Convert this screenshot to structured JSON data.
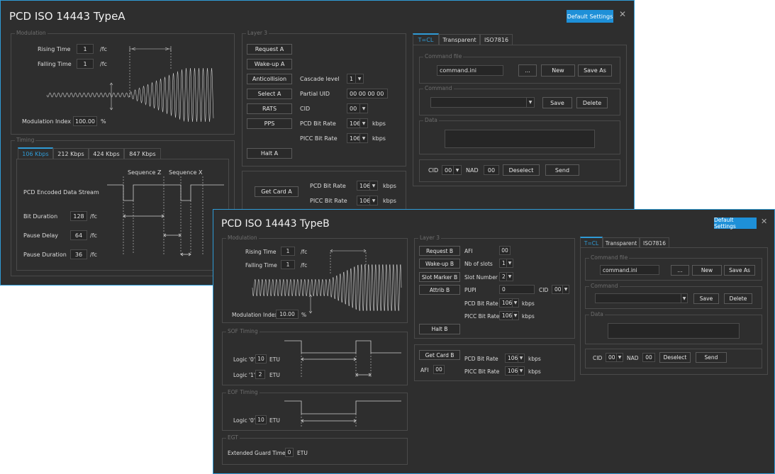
{
  "win_a": {
    "title": "PCD ISO 14443 TypeA",
    "default_settings": "Default Settings",
    "close": "✕",
    "modulation": {
      "label": "Modulation",
      "rising_time_label": "Rising Time",
      "rising_time": "1",
      "rising_unit": "/fc",
      "falling_time_label": "Falling Time",
      "falling_time": "1",
      "falling_unit": "/fc",
      "index_label": "Modulation Index",
      "index": "100.00",
      "index_unit": "%"
    },
    "timing": {
      "label": "Timing",
      "tabs": [
        "106 Kbps",
        "212 Kbps",
        "424 Kbps",
        "847 Kbps"
      ],
      "seq_z": "Sequence Z",
      "seq_x": "Sequence X",
      "stream_label": "PCD Encoded Data Stream",
      "bit_duration_label": "Bit Duration",
      "bit_duration": "128",
      "pause_delay_label": "Pause Delay",
      "pause_delay": "64",
      "pause_duration_label": "Pause Duration",
      "pause_duration": "36",
      "unit": "/fc"
    },
    "layer3": {
      "label": "Layer 3",
      "request_a": "Request A",
      "wakeup_a": "Wake-up A",
      "anticollision": "Anticollision",
      "select_a": "Select A",
      "rats": "RATS",
      "pps": "PPS",
      "halt_a": "Halt A",
      "cascade_label": "Cascade level",
      "cascade": "1",
      "partial_uid_label": "Partial UID",
      "partial_uid": "00 00 00 00",
      "cid_label": "CID",
      "cid": "00",
      "pcd_rate_label": "PCD Bit Rate",
      "pcd_rate": "106",
      "picc_rate_label": "PICC Bit Rate",
      "picc_rate": "106",
      "unit": "kbps"
    },
    "getcard": {
      "button": "Get Card A",
      "pcd_rate_label": "PCD Bit Rate",
      "pcd_rate": "106",
      "picc_rate_label": "PICC Bit Rate",
      "picc_rate": "106",
      "unit": "kbps"
    },
    "right": {
      "tabs": [
        "T=CL",
        "Transparent",
        "ISO7816"
      ],
      "command_file_label": "Command file",
      "command_file": "command.ini",
      "browse": "...",
      "new": "New",
      "save_as": "Save As",
      "command_label": "Command",
      "save": "Save",
      "delete": "Delete",
      "data_label": "Data",
      "cid_label": "CID",
      "cid": "00",
      "nad_label": "NAD",
      "nad": "00",
      "deselect": "Deselect",
      "send": "Send"
    }
  },
  "win_b": {
    "title": "PCD ISO 14443 TypeB",
    "default_settings": "Default Settings",
    "close": "✕",
    "modulation": {
      "label": "Modulation",
      "rising_time_label": "Rising Time",
      "rising_time": "1",
      "rising_unit": "/fc",
      "falling_time_label": "Falling Time",
      "falling_time": "1",
      "falling_unit": "/fc",
      "index_label": "Modulation Index",
      "index": "10.00",
      "index_unit": "%"
    },
    "sof": {
      "label": "SOF Timing",
      "logic0_label": "Logic '0'",
      "logic0": "10",
      "logic1_label": "Logic '1'",
      "logic1": "2",
      "unit": "ETU"
    },
    "eof": {
      "label": "EOF Timing",
      "logic0_label": "Logic '0'",
      "logic0": "10",
      "unit": "ETU"
    },
    "egt": {
      "label": "EGT",
      "label2": "Extended Guard Time",
      "value": "0",
      "unit": "ETU"
    },
    "layer3": {
      "label": "Layer 3",
      "request_b": "Request B",
      "wakeup_b": "Wake-up B",
      "slot_marker_b": "Slot Marker B",
      "attrib_b": "Attrib B",
      "halt_b": "Halt B",
      "afi_label": "AFI",
      "afi": "00",
      "slots_label": "Nb of slots",
      "slots": "1",
      "slot_number_label": "Slot Number",
      "slot_number": "2",
      "pupi_label": "PUPI",
      "pupi": "0",
      "cid_label": "CID",
      "cid": "00",
      "pcd_rate_label": "PCD Bit Rate",
      "pcd_rate": "106",
      "picc_rate_label": "PICC Bit Rate",
      "picc_rate": "106",
      "unit": "kbps"
    },
    "getcard": {
      "button": "Get Card B",
      "afi_label": "AFI",
      "afi": "00",
      "pcd_rate_label": "PCD Bit Rate",
      "pcd_rate": "106",
      "picc_rate_label": "PICC Bit Rate",
      "picc_rate": "106",
      "unit": "kbps"
    },
    "right": {
      "tabs": [
        "T=CL",
        "Transparent",
        "ISO7816"
      ],
      "command_file_label": "Command file",
      "command_file": "command.ini",
      "browse": "...",
      "new": "New",
      "save_as": "Save As",
      "command_label": "Command",
      "save": "Save",
      "delete": "Delete",
      "data_label": "Data",
      "cid_label": "CID",
      "cid": "00",
      "nad_label": "NAD",
      "nad": "00",
      "deselect": "Deselect",
      "send": "Send"
    }
  }
}
